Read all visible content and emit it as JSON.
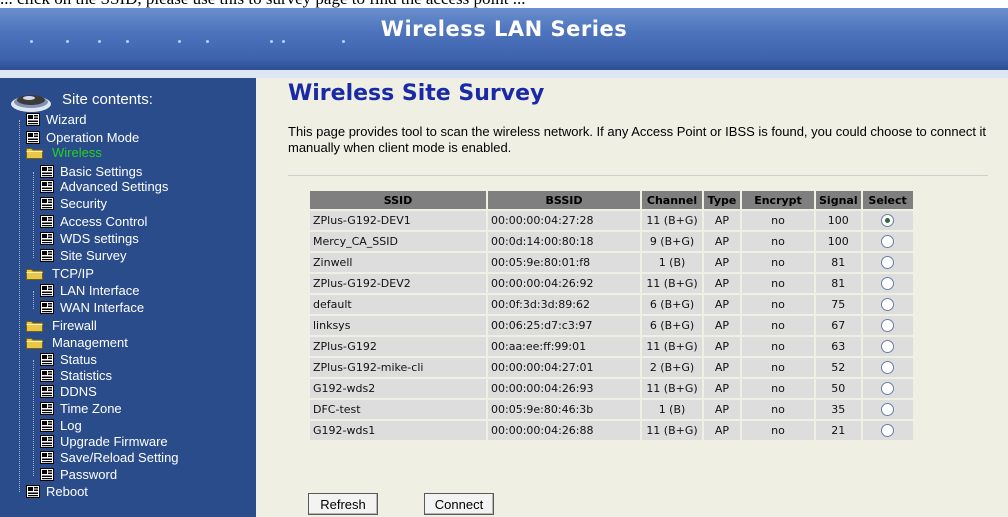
{
  "doc": {
    "caption": "... click on the SSID, please use this to survey page to find the access point ..."
  },
  "banner": {
    "title": "Wireless LAN Series"
  },
  "sidebar": {
    "heading": "Site contents:",
    "items": [
      {
        "label": "Wizard",
        "type": "page"
      },
      {
        "label": "Operation Mode",
        "type": "page"
      },
      {
        "label": "Wireless",
        "type": "folder",
        "active": true
      },
      {
        "label": "Basic Settings",
        "type": "page"
      },
      {
        "label": "Advanced Settings",
        "type": "page"
      },
      {
        "label": "Security",
        "type": "page"
      },
      {
        "label": "Access Control",
        "type": "page"
      },
      {
        "label": "WDS settings",
        "type": "page"
      },
      {
        "label": "Site Survey",
        "type": "page"
      },
      {
        "label": "TCP/IP",
        "type": "folder"
      },
      {
        "label": "LAN Interface",
        "type": "page"
      },
      {
        "label": "WAN Interface",
        "type": "page"
      },
      {
        "label": "Firewall",
        "type": "folder"
      },
      {
        "label": "Management",
        "type": "folder"
      },
      {
        "label": "Status",
        "type": "page"
      },
      {
        "label": "Statistics",
        "type": "page"
      },
      {
        "label": "DDNS",
        "type": "page"
      },
      {
        "label": "Time Zone",
        "type": "page"
      },
      {
        "label": "Log",
        "type": "page"
      },
      {
        "label": "Upgrade Firmware",
        "type": "page"
      },
      {
        "label": "Save/Reload Setting",
        "type": "page"
      },
      {
        "label": "Password",
        "type": "page"
      },
      {
        "label": "Reboot",
        "type": "page"
      }
    ]
  },
  "main": {
    "title": "Wireless Site Survey",
    "description": "This page provides tool to scan the wireless network. If any Access Point or IBSS is found, you could choose to connect it manually when client mode is enabled.",
    "table": {
      "headers": [
        "SSID",
        "BSSID",
        "Channel",
        "Type",
        "Encrypt",
        "Signal",
        "Select"
      ],
      "rows": [
        {
          "ssid": "ZPlus-G192-DEV1",
          "bssid": "00:00:00:04:27:28",
          "channel": "11 (B+G)",
          "type": "AP",
          "encrypt": "no",
          "signal": "100",
          "selected": true
        },
        {
          "ssid": "Mercy_CA_SSID",
          "bssid": "00:0d:14:00:80:18",
          "channel": "9 (B+G)",
          "type": "AP",
          "encrypt": "no",
          "signal": "100",
          "selected": false
        },
        {
          "ssid": "Zinwell",
          "bssid": "00:05:9e:80:01:f8",
          "channel": "1 (B)",
          "type": "AP",
          "encrypt": "no",
          "signal": "81",
          "selected": false
        },
        {
          "ssid": "ZPlus-G192-DEV2",
          "bssid": "00:00:00:04:26:92",
          "channel": "11 (B+G)",
          "type": "AP",
          "encrypt": "no",
          "signal": "81",
          "selected": false
        },
        {
          "ssid": "default",
          "bssid": "00:0f:3d:3d:89:62",
          "channel": "6 (B+G)",
          "type": "AP",
          "encrypt": "no",
          "signal": "75",
          "selected": false
        },
        {
          "ssid": "linksys",
          "bssid": "00:06:25:d7:c3:97",
          "channel": "6 (B+G)",
          "type": "AP",
          "encrypt": "no",
          "signal": "67",
          "selected": false
        },
        {
          "ssid": "ZPlus-G192",
          "bssid": "00:aa:ee:ff:99:01",
          "channel": "11 (B+G)",
          "type": "AP",
          "encrypt": "no",
          "signal": "63",
          "selected": false
        },
        {
          "ssid": "ZPlus-G192-mike-cli",
          "bssid": "00:00:00:04:27:01",
          "channel": "2 (B+G)",
          "type": "AP",
          "encrypt": "no",
          "signal": "52",
          "selected": false
        },
        {
          "ssid": "G192-wds2",
          "bssid": "00:00:00:04:26:93",
          "channel": "11 (B+G)",
          "type": "AP",
          "encrypt": "no",
          "signal": "50",
          "selected": false
        },
        {
          "ssid": "DFC-test",
          "bssid": "00:05:9e:80:46:3b",
          "channel": "1 (B)",
          "type": "AP",
          "encrypt": "no",
          "signal": "35",
          "selected": false
        },
        {
          "ssid": "G192-wds1",
          "bssid": "00:00:00:04:26:88",
          "channel": "11 (B+G)",
          "type": "AP",
          "encrypt": "no",
          "signal": "21",
          "selected": false
        }
      ]
    },
    "buttons": {
      "refresh": "Refresh",
      "connect": "Connect"
    }
  },
  "colors": {
    "sidebar_bg": "#2a4c8b",
    "active_item": "#22d122",
    "title_blue": "#1a2aa6",
    "content_bg": "#efefe4",
    "header_cell": "#7f7f7f",
    "data_cell": "#dddddd"
  },
  "icons": {
    "page": "page-icon",
    "folder": "folder-icon",
    "site": "globe-icon",
    "radio": "radio-button"
  }
}
